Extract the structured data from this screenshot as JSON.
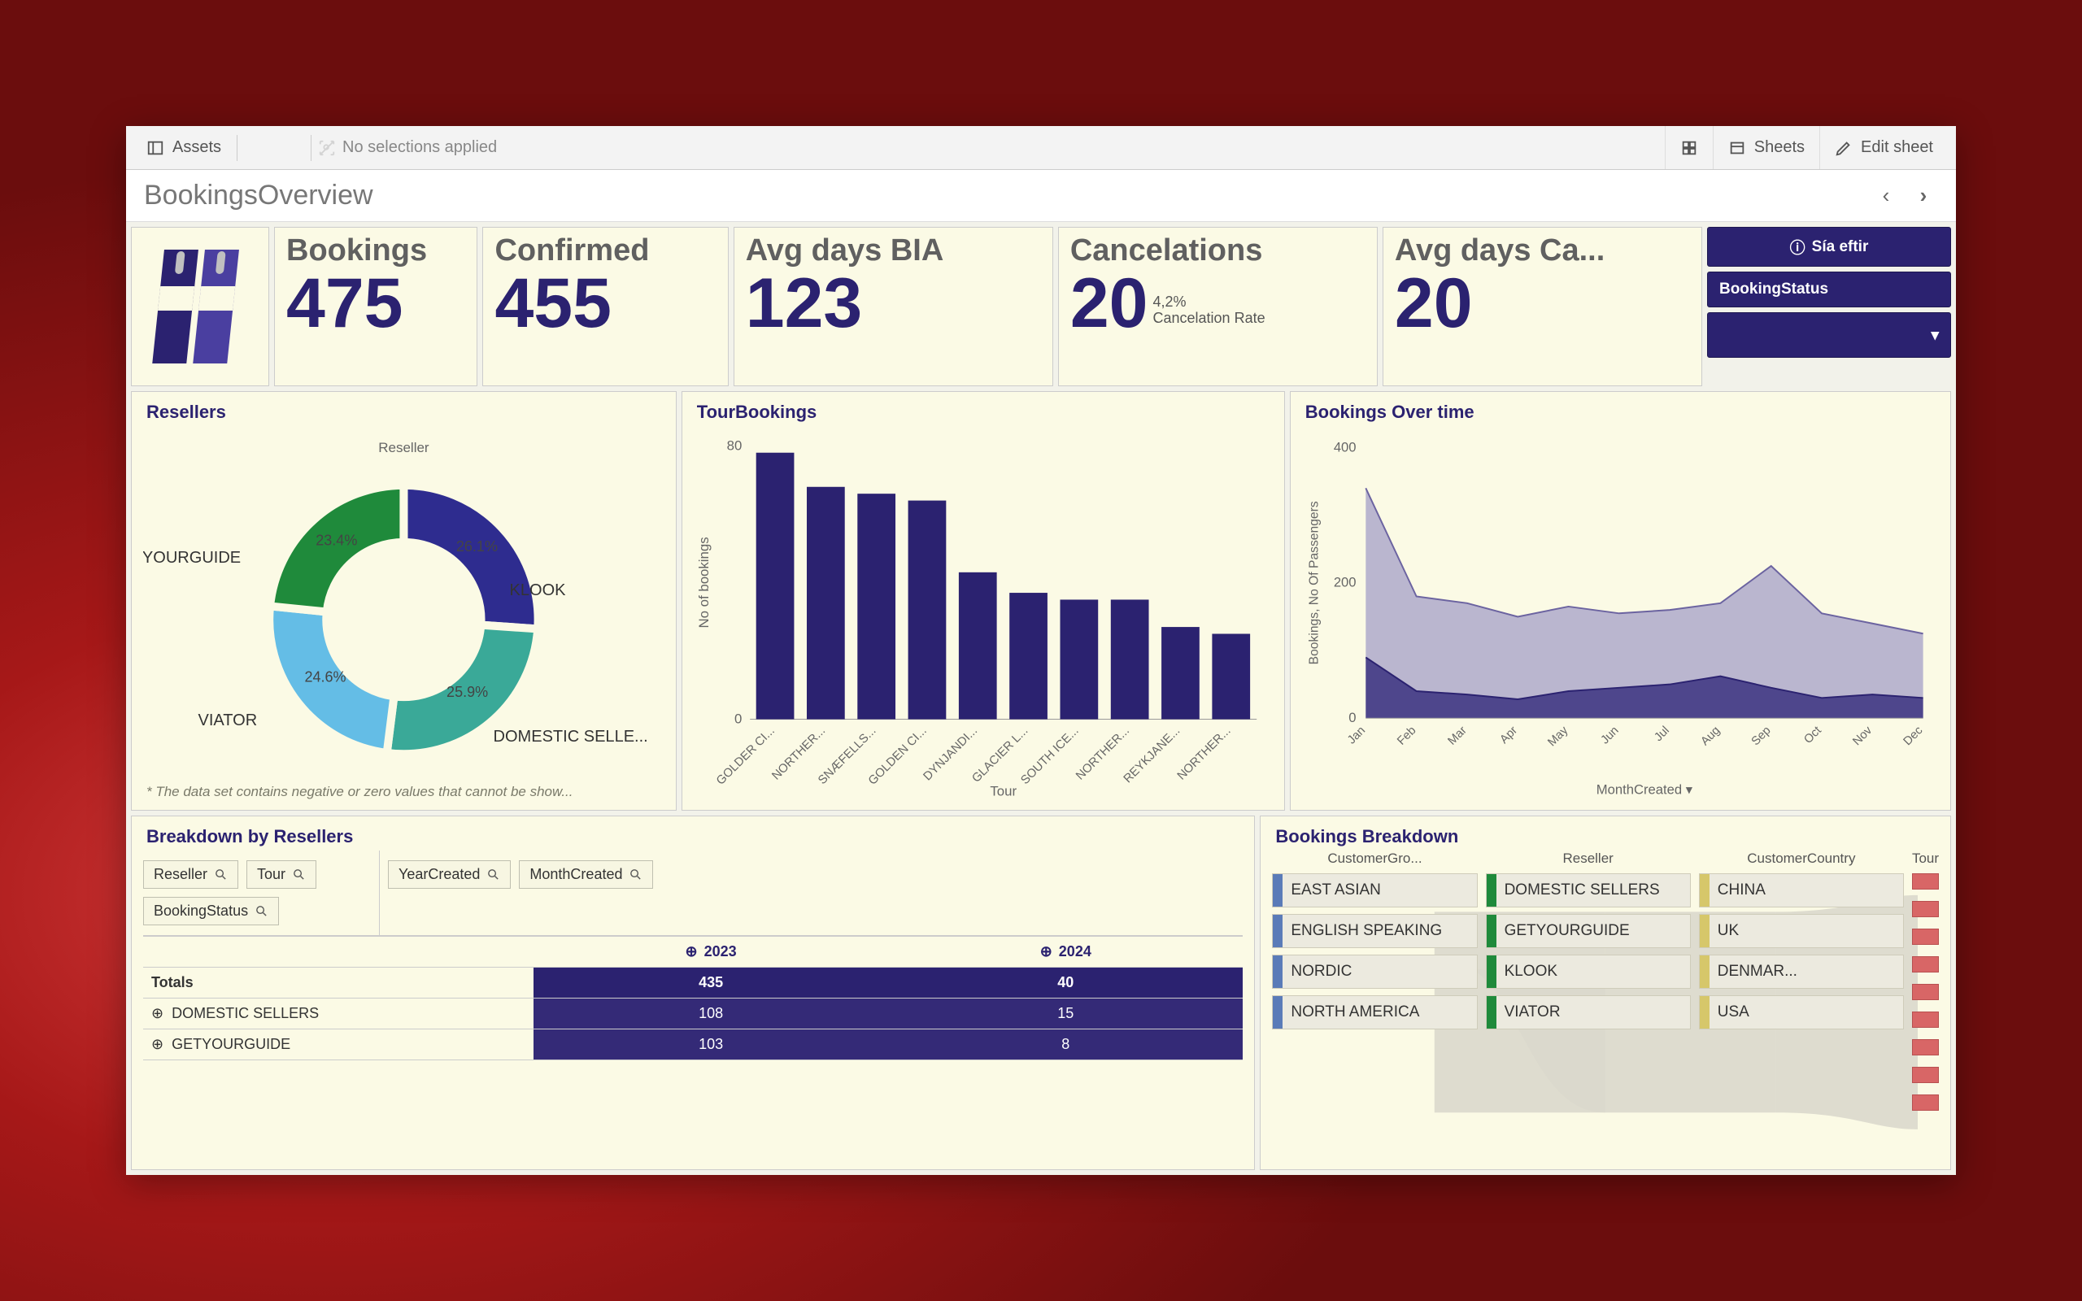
{
  "toolbar": {
    "assets": "Assets",
    "no_selections": "No selections applied",
    "sheets": "Sheets",
    "edit": "Edit sheet"
  },
  "page_title": "BookingsOverview",
  "kpi": {
    "bookings": {
      "label": "Bookings",
      "value": "475"
    },
    "confirmed": {
      "label": "Confirmed",
      "value": "455"
    },
    "avg_bia": {
      "label": "Avg days BIA",
      "value": "123"
    },
    "cancel": {
      "label": "Cancelations",
      "value": "20",
      "rate_pct": "4,2%",
      "rate_lbl": "Cancelation Rate"
    },
    "avg_ca": {
      "label": "Avg days Ca...",
      "value": "20"
    }
  },
  "side": {
    "sia": "Sía eftir",
    "bookingstatus": "BookingStatus"
  },
  "resellers": {
    "title": "Resellers",
    "legend_title": "Reseller",
    "footnote": "* The data set contains negative or zero values that cannot be show...",
    "slices": [
      {
        "name": "KLOOK",
        "pct": 26.1,
        "color": "#2e2c8f"
      },
      {
        "name": "DOMESTIC SELLE...",
        "pct": 25.9,
        "color": "#3aa998"
      },
      {
        "name": "VIATOR",
        "pct": 24.6,
        "color": "#64bde6"
      },
      {
        "name": "GETYOURGUIDE",
        "pct": 23.4,
        "color": "#1f8a3b"
      }
    ]
  },
  "tourbookings": {
    "title": "TourBookings",
    "ylabel": "No of bookings",
    "xlabel": "Tour"
  },
  "overtime": {
    "title": "Bookings Over time",
    "ylabel": "Bookings, No Of Passengers",
    "xlabel": "MonthCreated"
  },
  "breakdown": {
    "title": "Breakdown by Resellers",
    "chips_left": [
      "Reseller",
      "Tour",
      "BookingStatus"
    ],
    "chips_right": [
      "YearCreated",
      "MonthCreated"
    ],
    "col1": "2023",
    "col2": "2024",
    "totals_label": "Totals",
    "totals": [
      "435",
      "40"
    ],
    "rows": [
      {
        "label": "DOMESTIC SELLERS",
        "v1": "108",
        "v2": "15"
      },
      {
        "label": "GETYOURGUIDE",
        "v1": "103",
        "v2": "8"
      }
    ]
  },
  "sankey": {
    "title": "Bookings Breakdown",
    "cols": [
      "CustomerGro...",
      "Reseller",
      "CustomerCountry",
      "Tour"
    ],
    "group": [
      {
        "name": "EAST ASIAN",
        "color": "#5a7bb8"
      },
      {
        "name": "ENGLISH SPEAKING",
        "color": "#5a7bb8"
      },
      {
        "name": "NORDIC",
        "color": "#5a7bb8"
      },
      {
        "name": "NORTH AMERICA",
        "color": "#5a7bb8"
      }
    ],
    "reseller": [
      {
        "name": "DOMESTIC SELLERS",
        "color": "#1f8a3b"
      },
      {
        "name": "GETYOURGUIDE",
        "color": "#1f8a3b"
      },
      {
        "name": "KLOOK",
        "color": "#1f8a3b"
      },
      {
        "name": "VIATOR",
        "color": "#1f8a3b"
      }
    ],
    "country": [
      {
        "name": "CHINA",
        "color": "#d6c76a"
      },
      {
        "name": "UK",
        "color": "#d6c76a"
      },
      {
        "name": "DENMAR...",
        "color": "#d6c76a"
      },
      {
        "name": "USA",
        "color": "#d6c76a"
      }
    ]
  },
  "chart_data": [
    {
      "type": "pie",
      "title": "Resellers",
      "series": [
        {
          "name": "KLOOK",
          "value": 26.1
        },
        {
          "name": "DOMESTIC SELLERS",
          "value": 25.9
        },
        {
          "name": "VIATOR",
          "value": 24.6
        },
        {
          "name": "GETYOURGUIDE",
          "value": 23.4
        }
      ]
    },
    {
      "type": "bar",
      "title": "TourBookings",
      "xlabel": "Tour",
      "ylabel": "No of bookings",
      "ylim": [
        0,
        80
      ],
      "categories": [
        "GOLDER CI...",
        "NORTHER...",
        "SNÆFELLS...",
        "GOLDEN CI...",
        "DYNJANDI...",
        "GLACIER L...",
        "SOUTH ICE...",
        "NORTHER...",
        "REYKJANE...",
        "NORTHER..."
      ],
      "values": [
        78,
        68,
        66,
        64,
        43,
        37,
        35,
        35,
        27,
        25
      ]
    },
    {
      "type": "area",
      "title": "Bookings Over time",
      "xlabel": "MonthCreated",
      "ylabel": "Bookings, No Of Passengers",
      "ylim": [
        0,
        400
      ],
      "categories": [
        "Jan",
        "Feb",
        "Mar",
        "Apr",
        "May",
        "Jun",
        "Jul",
        "Aug",
        "Sep",
        "Oct",
        "Nov",
        "Dec"
      ],
      "series": [
        {
          "name": "No Of Passengers",
          "values": [
            340,
            180,
            170,
            150,
            165,
            155,
            160,
            170,
            225,
            155,
            140,
            125
          ]
        },
        {
          "name": "Bookings",
          "values": [
            90,
            40,
            35,
            28,
            40,
            45,
            50,
            62,
            45,
            30,
            35,
            30
          ]
        }
      ]
    },
    {
      "type": "table",
      "title": "Breakdown by Resellers",
      "columns": [
        "",
        "2023",
        "2024"
      ],
      "rows": [
        [
          "Totals",
          435,
          40
        ],
        [
          "DOMESTIC SELLERS",
          108,
          15
        ],
        [
          "GETYOURGUIDE",
          103,
          8
        ]
      ]
    }
  ]
}
